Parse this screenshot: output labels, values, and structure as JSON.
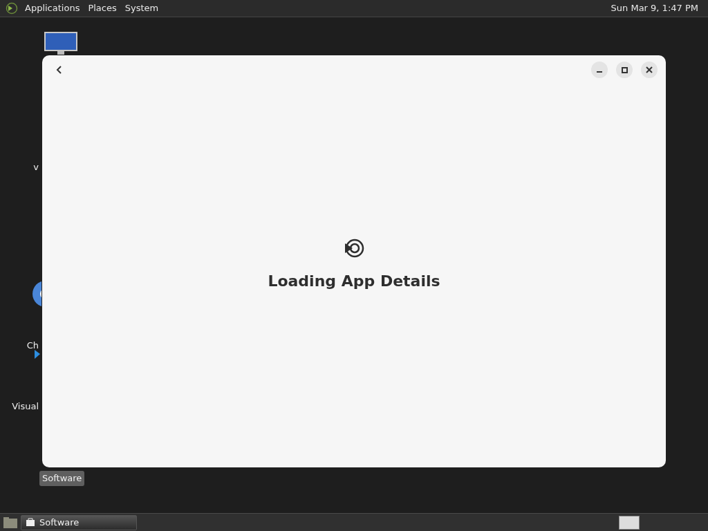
{
  "top_panel": {
    "menus": [
      "Applications",
      "Places",
      "System"
    ],
    "clock": "Sun Mar 9, 1:47 PM"
  },
  "desktop_icons": [
    {
      "kind": "monitor",
      "selected": false
    },
    {
      "label": "v",
      "kind": "none",
      "selected": false
    },
    {
      "label": "Ch",
      "kind": "browser",
      "selected": false
    },
    {
      "label": "Visual",
      "kind": "editor",
      "selected": false
    },
    {
      "label": "Software",
      "kind": "none",
      "selected": true
    }
  ],
  "window": {
    "message": "Loading App Details"
  },
  "taskbar": {
    "tasks": [
      {
        "label": "Software",
        "selected": true
      }
    ]
  }
}
